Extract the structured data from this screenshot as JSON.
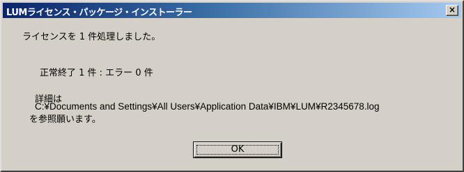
{
  "window": {
    "title": "LUMライセンス・パッケージ・インストーラー",
    "close_label": "×"
  },
  "message": {
    "processed": "ライセンスを 1 件処理しました。",
    "status": "正常終了 1 件 : エラー 0 件",
    "detail_label": "詳細は",
    "log_path": "C:¥Documents and Settings¥All Users¥Application Data¥IBM¥LUM¥R2345678.log",
    "refer": "を参照願います。"
  },
  "buttons": {
    "ok_label": "OK"
  },
  "colors": {
    "dialog_background": "#d4d0c8",
    "titlebar_start": "#0a246a",
    "titlebar_end": "#a6caf0",
    "title_text": "#ffffff"
  },
  "icons": {
    "close": "close-icon"
  }
}
